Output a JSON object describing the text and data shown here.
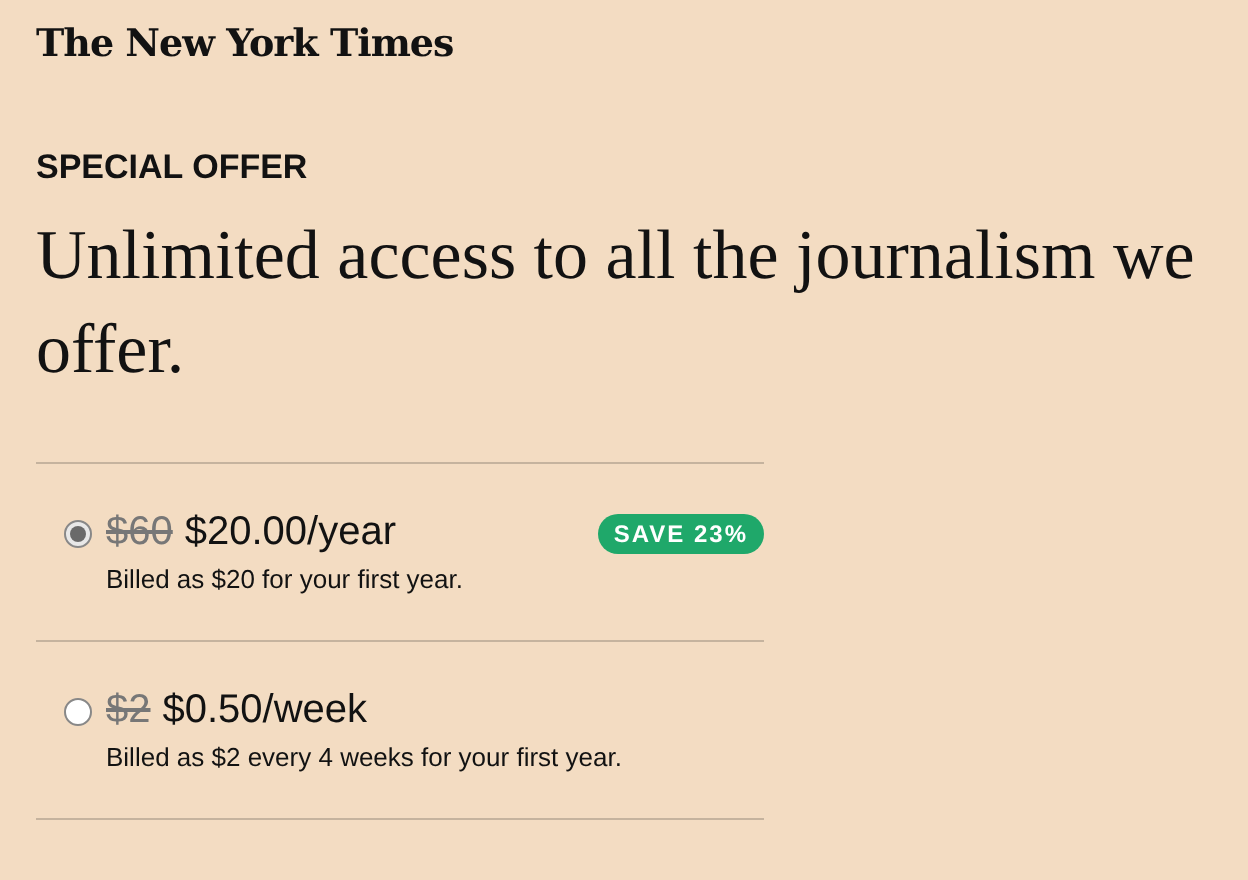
{
  "logo": "The New York Times",
  "eyebrow": "SPECIAL OFFER",
  "headline": "Unlimited access to all the journalism we offer.",
  "plans": [
    {
      "old_price": "$60",
      "price": "$20.00/year",
      "note": "Billed as $20 for your first year.",
      "badge": "SAVE 23%",
      "selected": true
    },
    {
      "old_price": "$2",
      "price": "$0.50/week",
      "note": "Billed as $2 every 4 weeks for your first year.",
      "selected": false
    }
  ]
}
